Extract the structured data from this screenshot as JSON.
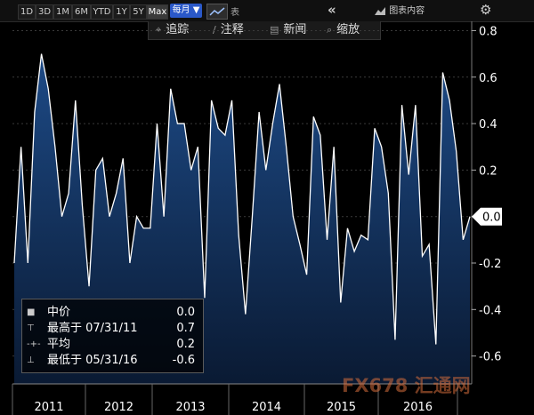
{
  "toolbar": {
    "ranges": [
      "1D",
      "3D",
      "1M",
      "6M",
      "YTD",
      "1Y",
      "5Y",
      "Max"
    ],
    "selected_range": "Max",
    "frequency": "每月 ▼",
    "table_label": "表",
    "collapse_glyph": "«",
    "chart_template_label": "图表内容",
    "settings_glyph": "⚙"
  },
  "subbar": {
    "track": "追踪",
    "annotate": "注释",
    "news": "新闻",
    "zoom": "缩放"
  },
  "legend": {
    "rows": [
      {
        "icon": "■",
        "label": "中价",
        "value": "0.0"
      },
      {
        "icon": "⊤",
        "label": "最高于 07/31/11",
        "value": "0.7"
      },
      {
        "icon": "-+-",
        "label": "平均",
        "value": "0.2"
      },
      {
        "icon": "⊥",
        "label": "最低于 05/31/16",
        "value": "-0.6"
      }
    ]
  },
  "last_value_label": "0.0",
  "watermark": "FX678 汇通网",
  "colors": {
    "background": "#000000",
    "area_top": "#1d4a86",
    "area_bottom": "#0a1a33",
    "line": "#ffffff",
    "accent": "#2a58c8",
    "watermark": "#d66e3c"
  },
  "chart_data": {
    "type": "area",
    "title": "",
    "xlabel": "",
    "ylabel": "",
    "x_tick_labels": [
      "2011",
      "2012",
      "2013",
      "2014",
      "2015",
      "2016"
    ],
    "y_ticks": [
      0.8,
      0.6,
      0.4,
      0.2,
      0.0,
      -0.2,
      -0.4,
      -0.6
    ],
    "y_tick_labels": [
      "0.8",
      "0.6",
      "0.4",
      "0.2",
      "0.0",
      "-0.2",
      "-0.4",
      "-0.6"
    ],
    "ylim": [
      -0.72,
      0.84
    ],
    "x": [
      "2011-01",
      "2011-02",
      "2011-03",
      "2011-04",
      "2011-05",
      "2011-06",
      "2011-07",
      "2011-08",
      "2011-09",
      "2011-10",
      "2011-11",
      "2011-12",
      "2012-01",
      "2012-02",
      "2012-03",
      "2012-04",
      "2012-05",
      "2012-06",
      "2012-07",
      "2012-08",
      "2012-09",
      "2012-10",
      "2012-11",
      "2012-12",
      "2013-01",
      "2013-02",
      "2013-03",
      "2013-04",
      "2013-05",
      "2013-06",
      "2013-07",
      "2013-08",
      "2013-09",
      "2013-10",
      "2013-11",
      "2013-12",
      "2014-01",
      "2014-02",
      "2014-03",
      "2014-04",
      "2014-05",
      "2014-06",
      "2014-07",
      "2014-08",
      "2014-09",
      "2014-10",
      "2014-11",
      "2014-12",
      "2015-01",
      "2015-02",
      "2015-03",
      "2015-04",
      "2015-05",
      "2015-06",
      "2015-07",
      "2015-08",
      "2015-09",
      "2015-10",
      "2015-11",
      "2015-12",
      "2016-01",
      "2016-02",
      "2016-03",
      "2016-04",
      "2016-05",
      "2016-06",
      "2016-07",
      "2016-08"
    ],
    "values": [
      -0.2,
      0.3,
      -0.2,
      0.45,
      0.7,
      0.55,
      0.3,
      0.0,
      0.1,
      0.5,
      0.05,
      -0.3,
      0.2,
      0.25,
      0.0,
      0.1,
      0.25,
      -0.2,
      0.0,
      -0.05,
      -0.05,
      0.4,
      0.0,
      0.55,
      0.4,
      0.4,
      0.2,
      0.3,
      -0.35,
      0.5,
      0.38,
      0.35,
      0.5,
      -0.08,
      -0.42,
      0.0,
      0.45,
      0.2,
      0.4,
      0.57,
      0.3,
      0.0,
      -0.12,
      -0.25,
      0.43,
      0.35,
      -0.1,
      0.3,
      -0.37,
      -0.05,
      -0.15,
      -0.08,
      -0.1,
      0.38,
      0.3,
      0.1,
      -0.53,
      0.48,
      0.18,
      0.48,
      -0.17,
      -0.12,
      -0.55,
      0.62,
      0.5,
      0.28,
      -0.1,
      0.0
    ],
    "series": [
      {
        "name": "中价"
      }
    ],
    "legend_position": "bottom-left",
    "grid": true
  }
}
